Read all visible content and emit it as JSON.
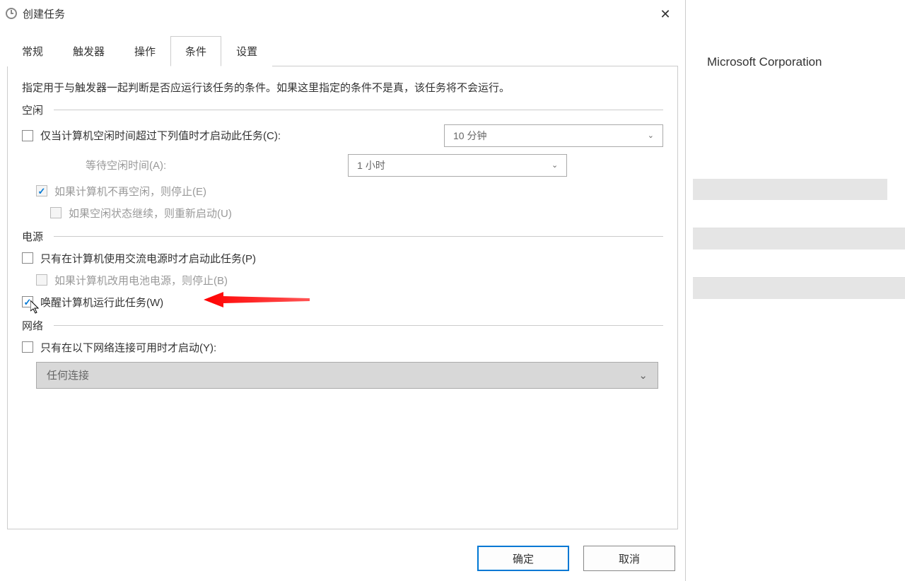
{
  "dialog": {
    "title": "创建任务"
  },
  "tabs": {
    "general": "常规",
    "triggers": "触发器",
    "actions": "操作",
    "conditions": "条件",
    "settings": "设置"
  },
  "content": {
    "description": "指定用于与触发器一起判断是否应运行该任务的条件。如果这里指定的条件不是真，该任务将不会运行。",
    "idle": {
      "section": "空闲",
      "startOnIdle": "仅当计算机空闲时间超过下列值时才启动此任务(C):",
      "idleDuration": "10 分钟",
      "waitLabel": "等待空闲时间(A):",
      "waitDuration": "1 小时",
      "stopIfNotIdle": "如果计算机不再空闲，则停止(E)",
      "restartOnIdle": "如果空闲状态继续，则重新启动(U)"
    },
    "power": {
      "section": "电源",
      "startOnAC": "只有在计算机使用交流电源时才启动此任务(P)",
      "stopOnBattery": "如果计算机改用电池电源，则停止(B)",
      "wakeToRun": "唤醒计算机运行此任务(W)"
    },
    "network": {
      "section": "网络",
      "startOnNetwork": "只有在以下网络连接可用时才启动(Y):",
      "anyConnection": "任何连接"
    }
  },
  "buttons": {
    "ok": "确定",
    "cancel": "取消"
  },
  "rightPanel": {
    "company": "Microsoft Corporation"
  }
}
